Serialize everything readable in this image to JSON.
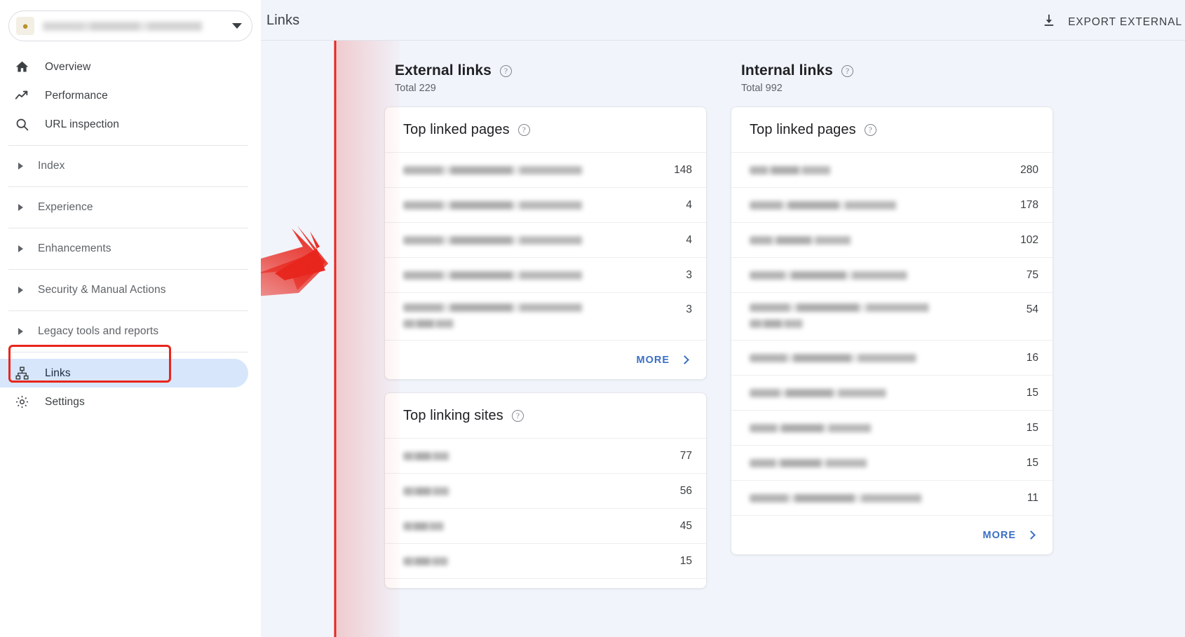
{
  "sidebar": {
    "property": {
      "favicon": "site-favicon",
      "name_redacted": "https://exampledomain.c...",
      "caret": "chevron-down-icon"
    },
    "primary": [
      {
        "label": "Overview",
        "icon": "home-icon"
      },
      {
        "label": "Performance",
        "icon": "trending-up-icon"
      },
      {
        "label": "URL inspection",
        "icon": "search-icon"
      }
    ],
    "groups": [
      {
        "label": "Index",
        "icon": "expand-triangle-icon"
      },
      {
        "label": "Experience",
        "icon": "expand-triangle-icon"
      },
      {
        "label": "Enhancements",
        "icon": "expand-triangle-icon"
      },
      {
        "label": "Security & Manual Actions",
        "icon": "expand-triangle-icon"
      },
      {
        "label": "Legacy tools and reports",
        "icon": "expand-triangle-icon"
      }
    ],
    "bottom": [
      {
        "label": "Links",
        "icon": "links-hierarchy-icon",
        "active": true
      },
      {
        "label": "Settings",
        "icon": "gear-icon",
        "active": false
      }
    ]
  },
  "header": {
    "title": "Links",
    "export_label": "EXPORT EXTERNAL",
    "export_icon": "download-icon"
  },
  "external": {
    "title": "External links",
    "total": "Total 229",
    "help_icon": "help-circle-icon",
    "top_linked_pages": {
      "title": "Top linked pages",
      "help_icon": "help-circle-icon",
      "rows": [
        {
          "url_redacted": "",
          "value": "148"
        },
        {
          "url_redacted": "",
          "value": "4"
        },
        {
          "url_redacted": "",
          "value": "4"
        },
        {
          "url_redacted": "",
          "value": "3"
        },
        {
          "url_redacted": "",
          "value": "3"
        }
      ],
      "more_label": "MORE",
      "more_icon": "chevron-right-icon"
    },
    "top_linking_sites": {
      "title": "Top linking sites",
      "help_icon": "help-circle-icon",
      "rows": [
        {
          "site_redacted": "",
          "value": "77"
        },
        {
          "site_redacted": "",
          "value": "56"
        },
        {
          "site_redacted": "",
          "value": "45"
        },
        {
          "site_redacted": "",
          "value": "15"
        }
      ]
    }
  },
  "internal": {
    "title": "Internal links",
    "total": "Total 992",
    "help_icon": "help-circle-icon",
    "top_linked_pages": {
      "title": "Top linked pages",
      "help_icon": "help-circle-icon",
      "rows": [
        {
          "url_redacted": "",
          "value": "280"
        },
        {
          "url_redacted": "",
          "value": "178"
        },
        {
          "url_redacted": "",
          "value": "102"
        },
        {
          "url_redacted": "",
          "value": "75"
        },
        {
          "url_redacted": "",
          "value": "54"
        },
        {
          "url_redacted": "",
          "value": "16"
        },
        {
          "url_redacted": "",
          "value": "15"
        },
        {
          "url_redacted": "",
          "value": "15"
        },
        {
          "url_redacted": "",
          "value": "15"
        },
        {
          "url_redacted": "",
          "value": "11"
        }
      ],
      "more_label": "MORE",
      "more_icon": "chevron-right-icon"
    }
  },
  "annotation": {
    "highlight_color": "#e8251c",
    "arrow_icon": "red-arrow-pointer"
  }
}
